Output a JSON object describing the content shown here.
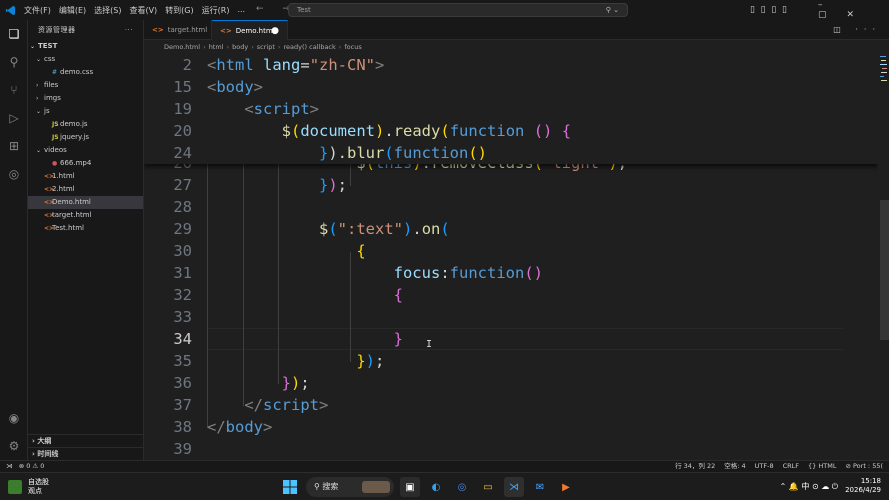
{
  "titlebar": {
    "menus": [
      "文件(F)",
      "编辑(E)",
      "选择(S)",
      "查看(V)",
      "转到(G)",
      "运行(R)",
      "..."
    ],
    "search": "Test",
    "nav_arrows": "← →"
  },
  "explorer": {
    "header": "资源管理器",
    "more": "···",
    "root": "TEST",
    "items": [
      {
        "label": "css",
        "chev": "⌄",
        "icon": ""
      },
      {
        "label": "demo.css",
        "chev": "",
        "icon": "#"
      },
      {
        "label": "files",
        "chev": "›",
        "icon": ""
      },
      {
        "label": "imgs",
        "chev": "›",
        "icon": ""
      },
      {
        "label": "js",
        "chev": "⌄",
        "icon": ""
      },
      {
        "label": "demo.js",
        "chev": "",
        "icon": "JS"
      },
      {
        "label": "jquery.js",
        "chev": "",
        "icon": "JS"
      },
      {
        "label": "videos",
        "chev": "⌄",
        "icon": ""
      },
      {
        "label": "666.mp4",
        "chev": "",
        "icon": "●"
      },
      {
        "label": "1.html",
        "chev": "",
        "icon": "<>"
      },
      {
        "label": "2.html",
        "chev": "",
        "icon": "<>"
      },
      {
        "label": "Demo.html",
        "chev": "",
        "icon": "<>"
      },
      {
        "label": "target.html",
        "chev": "",
        "icon": "<>"
      },
      {
        "label": "Test.html",
        "chev": "",
        "icon": "<>"
      }
    ],
    "outline": "大纲",
    "timeline": "时间线"
  },
  "tabs": [
    {
      "label": "target.html",
      "icon": "<>"
    },
    {
      "label": "Demo.html",
      "icon": "<>",
      "dirty": "●"
    }
  ],
  "breadcrumb": [
    "Demo.html",
    "html",
    "body",
    "script",
    "ready() callback",
    "focus"
  ],
  "editor": {
    "sticky_lines": [
      {
        "num": "2",
        "segments": [
          [
            "p",
            "<"
          ],
          [
            "t",
            "html"
          ],
          [
            "w",
            " "
          ],
          [
            "a",
            "lang"
          ],
          [
            "w",
            "="
          ],
          [
            "s",
            "\"zh-CN\""
          ],
          [
            "p",
            ">"
          ]
        ]
      },
      {
        "num": "15",
        "segments": [
          [
            "p",
            "<"
          ],
          [
            "t",
            "body"
          ],
          [
            "p",
            ">"
          ]
        ]
      },
      {
        "num": "19",
        "segments": [
          [
            "w",
            "    "
          ],
          [
            "p",
            "<"
          ],
          [
            "t",
            "script"
          ],
          [
            "p",
            ">"
          ]
        ]
      },
      {
        "num": "20",
        "segments": [
          [
            "w",
            "        "
          ],
          [
            "f",
            "$"
          ],
          [
            "b1",
            "("
          ],
          [
            "a",
            "document"
          ],
          [
            "b1",
            ")"
          ],
          [
            "w",
            "."
          ],
          [
            "f",
            "ready"
          ],
          [
            "b1",
            "("
          ],
          [
            "k",
            "function"
          ],
          [
            "w",
            " "
          ],
          [
            "b2",
            "()"
          ],
          [
            "w",
            " "
          ],
          [
            "b2",
            "{"
          ]
        ]
      },
      {
        "num": "24",
        "segments": [
          [
            "w",
            "            "
          ],
          [
            "b3",
            "}"
          ],
          [
            "w",
            ")."
          ],
          [
            "f",
            "blur"
          ],
          [
            "b3",
            "("
          ],
          [
            "k",
            "function"
          ],
          [
            "b1",
            "()"
          ]
        ]
      }
    ],
    "hidden_line": {
      "num": "26",
      "segments": [
        [
          "w",
          "                "
        ],
        [
          "f",
          "$"
        ],
        [
          "b1",
          "("
        ],
        [
          "k",
          "this"
        ],
        [
          "b1",
          ")"
        ],
        [
          "w",
          "."
        ],
        [
          "f",
          "removeClass"
        ],
        [
          "b1",
          "("
        ],
        [
          "s",
          "'light'"
        ],
        [
          "b1",
          ")"
        ],
        [
          "w",
          ";"
        ]
      ]
    },
    "lines": [
      {
        "num": "27",
        "segments": [
          [
            "w",
            "            "
          ],
          [
            "b3",
            "}"
          ],
          [
            "b2",
            ")"
          ],
          [
            "w",
            ";"
          ]
        ]
      },
      {
        "num": "28",
        "segments": []
      },
      {
        "num": "29",
        "segments": [
          [
            "w",
            "            "
          ],
          [
            "f",
            "$"
          ],
          [
            "b3",
            "("
          ],
          [
            "s",
            "\":text\""
          ],
          [
            "b3",
            ")"
          ],
          [
            "w",
            "."
          ],
          [
            "f",
            "on"
          ],
          [
            "b3",
            "("
          ]
        ]
      },
      {
        "num": "30",
        "segments": [
          [
            "w",
            "                "
          ],
          [
            "b1",
            "{"
          ]
        ]
      },
      {
        "num": "31",
        "segments": [
          [
            "w",
            "                    "
          ],
          [
            "a",
            "focus"
          ],
          [
            "w",
            ":"
          ],
          [
            "k",
            "function"
          ],
          [
            "b2",
            "()"
          ]
        ]
      },
      {
        "num": "32",
        "segments": [
          [
            "w",
            "                    "
          ],
          [
            "b2",
            "{"
          ]
        ]
      },
      {
        "num": "33",
        "segments": []
      },
      {
        "num": "34",
        "segments": [
          [
            "w",
            "                    "
          ],
          [
            "b2",
            "}"
          ]
        ]
      },
      {
        "num": "35",
        "segments": [
          [
            "w",
            "                "
          ],
          [
            "b1",
            "}"
          ],
          [
            "b3",
            ")"
          ],
          [
            "w",
            ";"
          ]
        ]
      },
      {
        "num": "36",
        "segments": [
          [
            "w",
            "        "
          ],
          [
            "b2",
            "}"
          ],
          [
            "b1",
            ")"
          ],
          [
            "w",
            ";"
          ]
        ]
      },
      {
        "num": "37",
        "segments": [
          [
            "w",
            "    "
          ],
          [
            "p",
            "</"
          ],
          [
            "t",
            "script"
          ],
          [
            "p",
            ">"
          ]
        ]
      },
      {
        "num": "38",
        "segments": [
          [
            "p",
            "</"
          ],
          [
            "t",
            "body"
          ],
          [
            "p",
            ">"
          ]
        ]
      },
      {
        "num": "39",
        "segments": []
      }
    ],
    "current_line": "34"
  },
  "statusbar": {
    "errors": "⊗ 0 ⚠ 0",
    "position": "行 34，列 22",
    "spaces": "空格: 4",
    "encoding": "UTF-8",
    "eol": "CRLF",
    "language": "{} HTML",
    "port": "⊘ Port : 55("
  },
  "taskbar": {
    "weather_line1": "自选股",
    "weather_line2": "观点",
    "search": "搜索",
    "time": "15:18",
    "date": "2026/4/29",
    "tray": "⌃ 🔔 中 ⊙ ☁ ⏻"
  }
}
